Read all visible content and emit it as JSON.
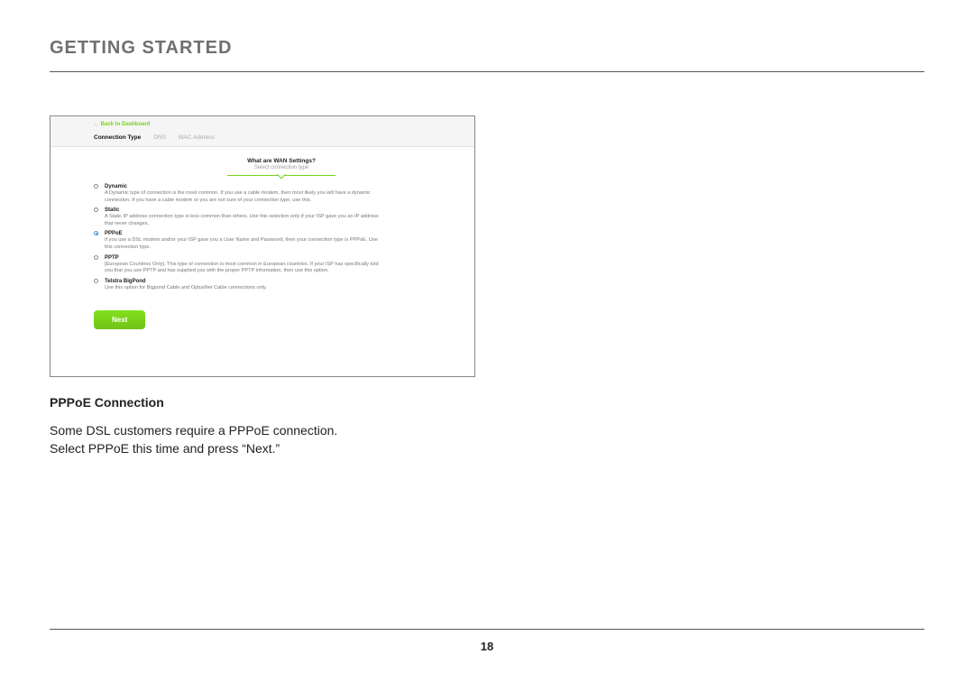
{
  "page": {
    "title": "GETTING STARTED",
    "number": "18"
  },
  "screenshot": {
    "back_link": "←  Back to Dashboard",
    "tabs": {
      "connection_type": "Connection Type",
      "dns": "DNS",
      "mac": "MAC Address"
    },
    "prompt": {
      "title": "What are WAN Settings?",
      "subtitle": "Select connection type"
    },
    "options": {
      "dynamic": {
        "label": "Dynamic",
        "desc": "A Dynamic type of connection is the most common. If you use a cable modem, then most likely you will have a dynamic connection. If you have a cable modem or you are not sure of your connection type, use this."
      },
      "static": {
        "label": "Static",
        "desc": "A Static IP address connection type is less common than others. Use this selection only if your ISP gave you an IP address that never changes."
      },
      "pppoe": {
        "label": "PPPoE",
        "desc": "If you use a DSL modem and/or your ISP gave you a User Name and Password, then your connection type is PPPoE. Use this connection type."
      },
      "pptp": {
        "label": "PPTP",
        "desc": "[European Countries Only]. This type of connection is most common in European countries. If your ISP has specifically told you that you use PPTP and has supplied you with the proper PPTP information, then use this option."
      },
      "telstra": {
        "label": "Telstra BigPond",
        "desc": "Use this option for Bigpond Cable and OptusNet Cable connections only."
      }
    },
    "next_button": "Next"
  },
  "caption": {
    "title": "PPPoE Connection",
    "line1": "Some DSL customers require a PPPoE connection.",
    "line2": "Select PPPoE this time and press “Next.”"
  }
}
